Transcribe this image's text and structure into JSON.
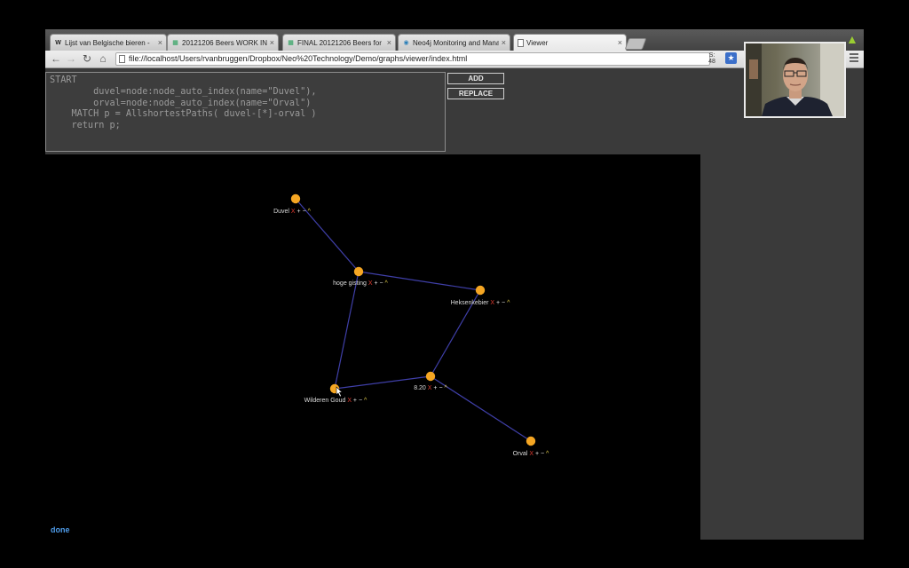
{
  "browser": {
    "tabs": [
      {
        "label": "Lijst van Belgische bieren - ",
        "icon": "W",
        "icon_name": "wikipedia-icon",
        "active": false
      },
      {
        "label": "20121206 Beers WORK IN P",
        "icon": "▦",
        "icon_name": "spreadsheet-icon",
        "active": false
      },
      {
        "label": "FINAL 20121206 Beers for ",
        "icon": "▦",
        "icon_name": "spreadsheet-icon",
        "active": false
      },
      {
        "label": "Neo4j Monitoring and Mana",
        "icon": "◉",
        "icon_name": "neo4j-icon",
        "active": false
      },
      {
        "label": "Viewer",
        "icon": "",
        "icon_name": "page-icon",
        "active": true
      }
    ],
    "url": "file://localhost/Users/rvanbruggen/Dropbox/Neo%20Technology/Demo/graphs/viewer/index.html",
    "extension_badge": "S:\n48"
  },
  "query": {
    "text": "START\n        duvel=node:node_auto_index(name=\"Duvel\"),\n        orval=node:node_auto_index(name=\"Orval\")\n    MATCH p = AllshortestPaths( duvel-[*]-orval )\n    return p;",
    "add_label": "ADD",
    "replace_label": "REPLACE"
  },
  "graph": {
    "nodes": [
      {
        "id": "duvel",
        "label": "Duvel"
      },
      {
        "id": "hoge",
        "label": "hoge gisting"
      },
      {
        "id": "heks",
        "label": "Heksenkebier"
      },
      {
        "id": "wild",
        "label": "Wilderen Goud"
      },
      {
        "id": "v820",
        "label": "8.20"
      },
      {
        "id": "orval",
        "label": "Orval"
      }
    ],
    "edges": [
      [
        "duvel",
        "hoge"
      ],
      [
        "hoge",
        "heks"
      ],
      [
        "hoge",
        "wild"
      ],
      [
        "heks",
        "v820"
      ],
      [
        "wild",
        "v820"
      ],
      [
        "v820",
        "orval"
      ]
    ],
    "controls": {
      "remove": "X",
      "expand": "+",
      "collapse": "−",
      "up": "^"
    },
    "colors": {
      "node": "#f5a623",
      "edge": "#3f3fa8",
      "label": "#dcdcdc",
      "remove": "#e03a2f",
      "expand": "#e8e8e8",
      "up": "#e8d24a"
    }
  },
  "status": {
    "text": "done"
  }
}
